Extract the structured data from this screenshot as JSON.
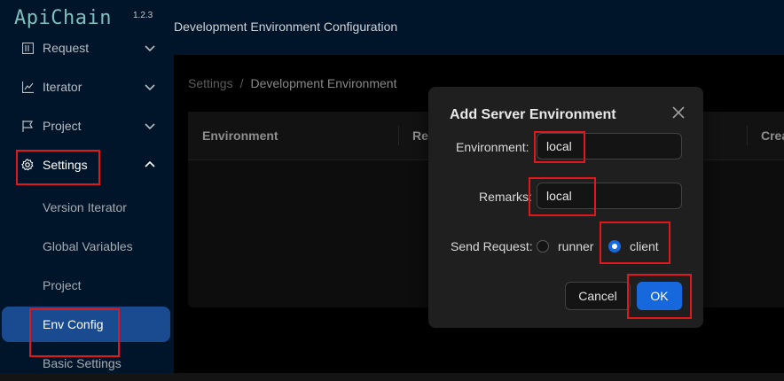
{
  "app": {
    "logo": "ApiChain",
    "version": "1.2.3"
  },
  "sidebar": {
    "items": [
      {
        "label": "Request",
        "icon": "request-icon"
      },
      {
        "label": "Iterator",
        "icon": "chart-line-icon"
      },
      {
        "label": "Project",
        "icon": "flag-icon"
      },
      {
        "label": "Settings",
        "icon": "gear-icon"
      }
    ],
    "sub_items": [
      {
        "label": "Version Iterator"
      },
      {
        "label": "Global Variables"
      },
      {
        "label": "Project"
      },
      {
        "label": "Env Config"
      },
      {
        "label": "Basic Settings"
      }
    ]
  },
  "header": {
    "title": "Development Environment Configuration"
  },
  "breadcrumb": {
    "root": "Settings",
    "separator": "/",
    "current": "Development Environment"
  },
  "table": {
    "columns": [
      "Environment",
      "Re",
      "Crea"
    ]
  },
  "modal": {
    "title": "Add Server Environment",
    "environment_label": "Environment:",
    "environment_value": "local",
    "remarks_label": "Remarks:",
    "remarks_value": "local",
    "send_request_label": "Send Request:",
    "options": [
      "runner",
      "client"
    ],
    "selected_option": "client",
    "cancel_label": "Cancel",
    "ok_label": "OK"
  },
  "colors": {
    "sidebar_bg": "#001529",
    "active_item_bg": "#1a4a8f",
    "primary": "#1668dc",
    "highlight": "#e0181b"
  }
}
